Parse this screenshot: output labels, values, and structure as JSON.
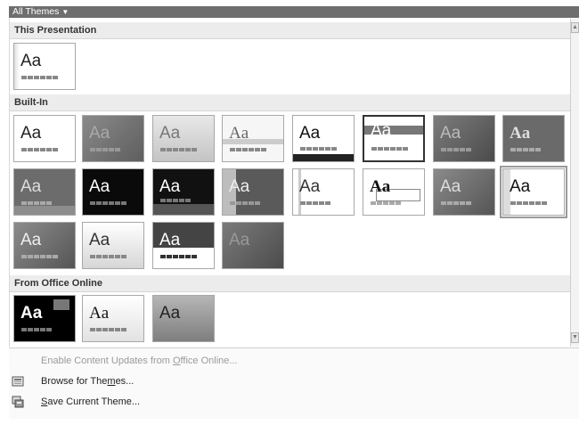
{
  "header": {
    "title": "All Themes"
  },
  "sections": {
    "presentation": "This Presentation",
    "builtin": "Built-In",
    "online": "From Office Online"
  },
  "thumb_text": "Aa",
  "menu": {
    "enable_updates": {
      "pre": "Enable Content Updates from ",
      "u": "O",
      "post": "ffice Online..."
    },
    "browse": {
      "pre": "Browse for The",
      "u": "m",
      "post": "es..."
    },
    "save": {
      "pre": "",
      "u": "S",
      "post": "ave Current Theme..."
    }
  },
  "icons": {
    "dropdown": "chevron-down-icon",
    "scroll_up": "scroll-up-arrow-icon",
    "scroll_down": "scroll-down-arrow-icon",
    "browse": "browse-folder-icon",
    "save": "save-theme-icon"
  }
}
